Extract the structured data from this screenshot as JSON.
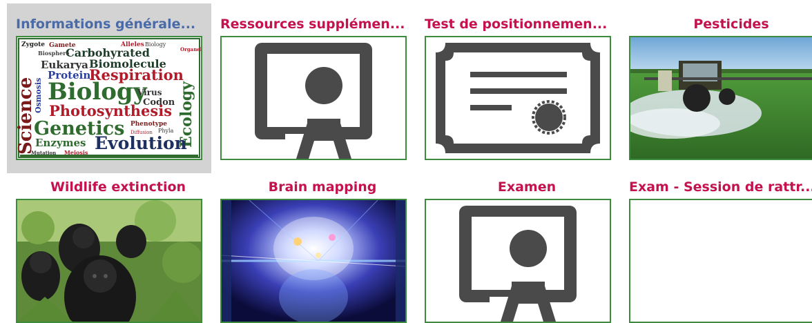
{
  "tiles": [
    {
      "title": "Informations générale...",
      "image": "biology-word-cloud",
      "selected": true
    },
    {
      "title": "Ressources supplémen...",
      "image": "presentation-user-icon"
    },
    {
      "title": "Test de positionnemen...",
      "image": "certificate-icon"
    },
    {
      "title": "Pesticides",
      "image": "tractor-spraying-field-photo"
    },
    {
      "title": "Wildlife extinction",
      "image": "gorillas-photo"
    },
    {
      "title": "Brain mapping",
      "image": "digital-brain-photo"
    },
    {
      "title": "Examen",
      "image": "presentation-user-icon"
    },
    {
      "title": "Exam - Session de rattr...",
      "image": "blank"
    }
  ],
  "word_cloud": {
    "words": [
      "Zygote",
      "Gamete",
      "Carbohyrated",
      "Biosphere",
      "Alleles",
      "Biology",
      "Organel",
      "Eukarya",
      "Biomolecule",
      "Protein",
      "Respiration",
      "Science",
      "Osmosis",
      "Biology",
      "Virus",
      "Ecology",
      "Codon",
      "Photosynthesis",
      "Genetics",
      "Phenotype",
      "Phyla",
      "Diffusion",
      "Enzymes",
      "Evolution",
      "Mutation",
      "Meiosis"
    ]
  },
  "colors": {
    "title_pink": "#c4124f",
    "title_blue": "#4a6aa8",
    "thumb_border": "#3d8b3d",
    "selected_bg": "#d3d3d3",
    "icon_gray": "#4a4a4a"
  }
}
